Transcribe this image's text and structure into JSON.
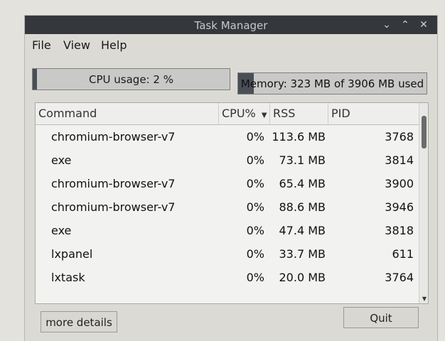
{
  "window": {
    "title": "Task Manager"
  },
  "menubar": {
    "file": "File",
    "view": "View",
    "help": "Help"
  },
  "cpu": {
    "text": "CPU usage: 2 %",
    "level": 0.02
  },
  "memory": {
    "text": "Memory: 323 MB of 3906 MB used",
    "level": 0.083
  },
  "columns": {
    "command": "Command",
    "cpu": "CPU%",
    "rss": "RSS",
    "pid": "PID"
  },
  "rows": [
    {
      "command": "chromium-browser-v7",
      "cpu": "0%",
      "rss": "113.6 MB",
      "pid": "3768"
    },
    {
      "command": "exe",
      "cpu": "0%",
      "rss": "73.1 MB",
      "pid": "3814"
    },
    {
      "command": "chromium-browser-v7",
      "cpu": "0%",
      "rss": "65.4 MB",
      "pid": "3900"
    },
    {
      "command": "chromium-browser-v7",
      "cpu": "0%",
      "rss": "88.6 MB",
      "pid": "3946"
    },
    {
      "command": "exe",
      "cpu": "0%",
      "rss": "47.4 MB",
      "pid": "3818"
    },
    {
      "command": "lxpanel",
      "cpu": "0%",
      "rss": "33.7 MB",
      "pid": "611"
    },
    {
      "command": "lxtask",
      "cpu": "0%",
      "rss": "20.0 MB",
      "pid": "3764"
    }
  ],
  "buttons": {
    "more_details": "more details",
    "quit": "Quit"
  },
  "icons": {
    "minimize": "chevron-down-icon",
    "maximize": "chevron-up-icon",
    "close": "close-icon",
    "sort": "sort-down-icon"
  }
}
